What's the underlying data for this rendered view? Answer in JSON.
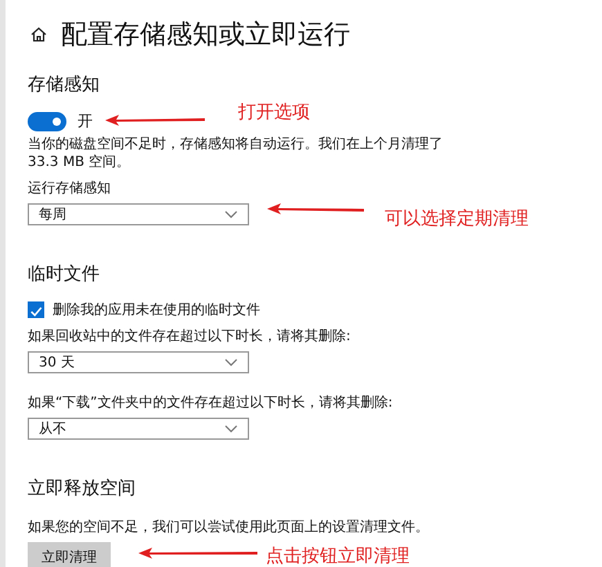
{
  "page": {
    "title": "配置存储感知或立即运行"
  },
  "storage_sense": {
    "heading": "存储感知",
    "toggle": {
      "on": true,
      "label": "开"
    },
    "description": "当你的磁盘空间不足时，存储感知将自动运行。我们在上个月清理了 33.3 MB 空间。",
    "run_label": "运行存储感知",
    "run_value": "每周"
  },
  "temp_files": {
    "heading": "临时文件",
    "checkbox": {
      "checked": true,
      "label": "删除我的应用未在使用的临时文件"
    },
    "dropdowns": [
      {
        "label": "如果回收站中的文件存在超过以下时长，请将其删除:",
        "value": "30 天"
      },
      {
        "label": "如果“下载”文件夹中的文件存在超过以下时长，请将其删除:",
        "value": "从不"
      }
    ]
  },
  "free_space": {
    "heading": "立即释放空间",
    "description": "如果您的空间不足，我们可以尝试使用此页面上的设置清理文件。",
    "button": "立即清理"
  },
  "annotations": [
    {
      "text": "打开选项"
    },
    {
      "text": "可以选择定期清理"
    },
    {
      "text": "点击按钮立即清理"
    }
  ]
}
